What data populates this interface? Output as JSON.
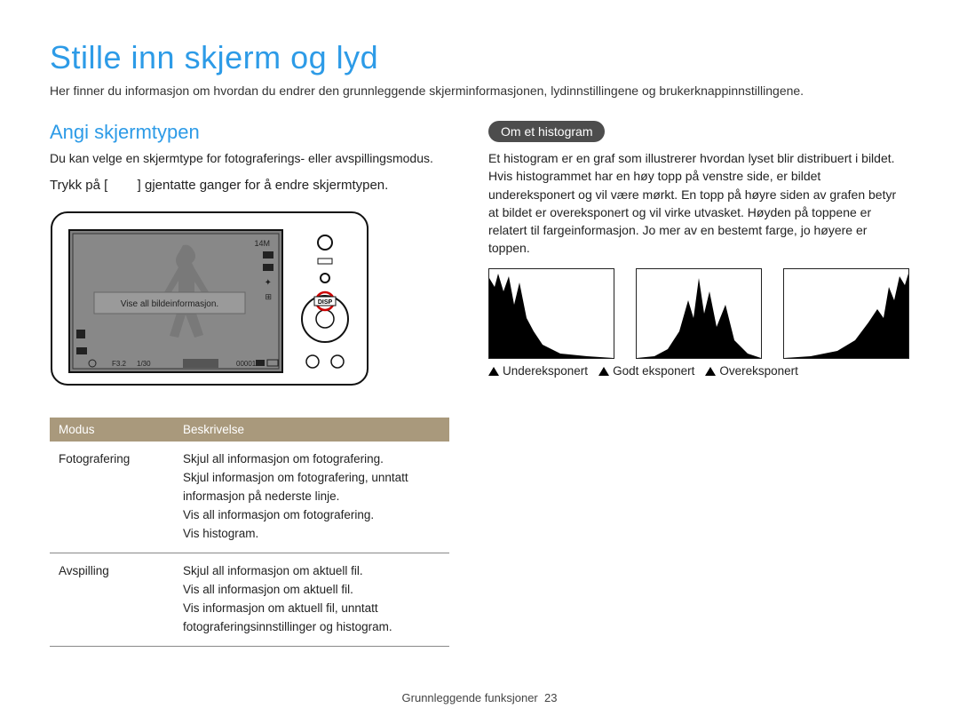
{
  "title": "Stille inn skjerm og lyd",
  "lead": "Her finner du informasjon om hvordan du endrer den grunnleggende skjerminformasjonen, lydinnstillingene og brukerknappinnstillingene.",
  "left": {
    "heading": "Angi skjermtypen",
    "intro": "Du kan velge en skjermtype for fotograferings- eller avspillingsmodus.",
    "instruction_pre": "Trykk på [",
    "instruction_post": "] gjentatte ganger for å endre skjermtypen.",
    "camera_tooltip": "Vise all bildeinformasjon.",
    "disp_label": "DISP",
    "lcd_bottom": {
      "aperture": "F3.2",
      "shutter": "1/30",
      "frames": "00001"
    },
    "table": {
      "headers": [
        "Modus",
        "Beskrivelse"
      ],
      "rows": [
        {
          "mode": "Fotografering",
          "desc": "Skjul all informasjon om fotografering.\nSkjul informasjon om fotografering, unntatt informasjon på nederste linje.\nVis all informasjon om fotografering.\nVis histogram."
        },
        {
          "mode": "Avspilling",
          "desc": "Skjul all informasjon om aktuell fil.\nVis all informasjon om aktuell fil.\nVis informasjon om aktuell fil, unntatt fotograferingsinnstillinger og histogram."
        }
      ]
    }
  },
  "right": {
    "pill": "Om et histogram",
    "body": "Et histogram er en graf som illustrerer hvordan lyset blir distribuert i bildet. Hvis histogrammet har en høy topp på venstre side, er bildet undereksponert og vil være mørkt. En topp på høyre siden av grafen betyr at bildet er overeksponert og vil virke utvasket. Høyden på toppene er relatert til fargeinformasjon. Jo mer av en bestemt farge, jo høyere er toppen.",
    "labels": [
      "Undereksponert",
      "Godt eksponert",
      "Overeksponert"
    ]
  },
  "footer": {
    "section": "Grunnleggende funksjoner",
    "page": "23"
  }
}
